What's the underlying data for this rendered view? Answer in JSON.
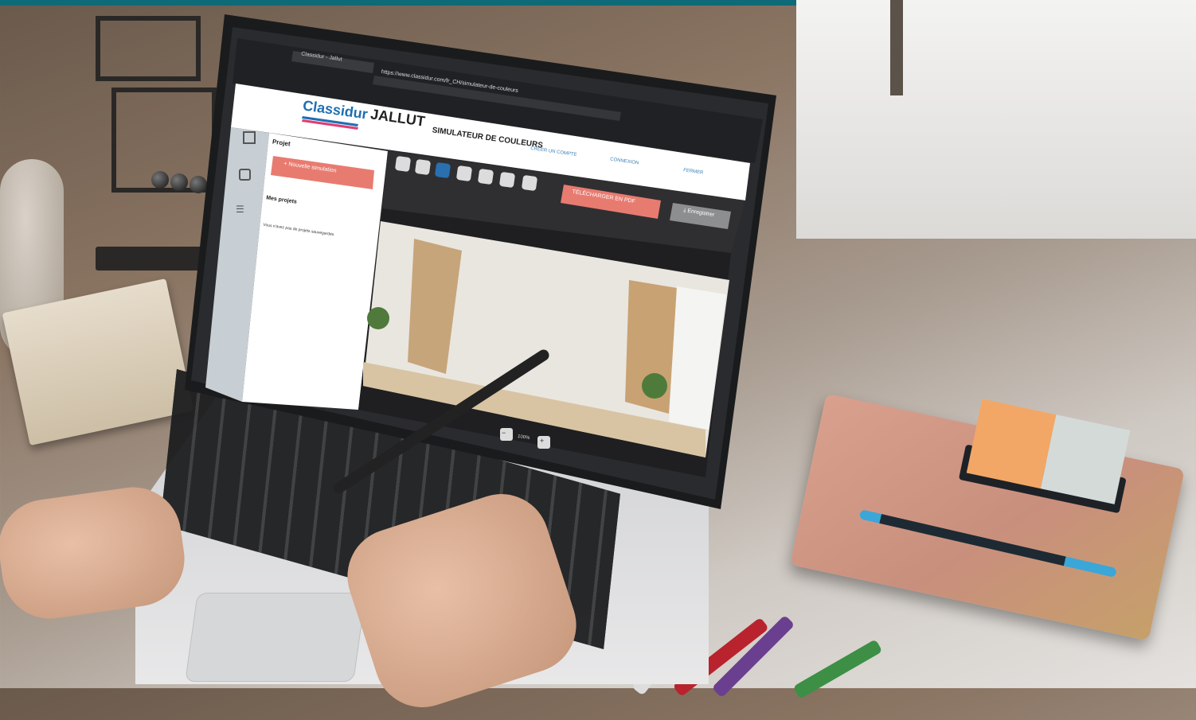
{
  "browser": {
    "tab_title": "Classidur - Jallut",
    "url": "https://www.classidur.com/fr_CH/simulateur-de-couleurs"
  },
  "brand": {
    "logo_1": "Classidur",
    "logo_2": "JALLUT",
    "accent": "#e87b70",
    "teal": "#0f6a78"
  },
  "header": {
    "title": "SIMULATEUR DE COULEURS",
    "create_account": "CRÉER UN COMPTE",
    "login": "CONNEXION",
    "close": "FERMER"
  },
  "sidebar": {
    "section_title": "Projet",
    "new_button": "Nouvelle simulation",
    "projects_title": "Mes projets",
    "empty_text": "Vous n'avez pas de projets sauvegardés"
  },
  "toolbar": {
    "download_pdf": "TÉLÉCHARGER EN PDF",
    "save": "Enregistrer"
  },
  "zoom": {
    "level": "100%"
  },
  "icons": [
    "qr-icon",
    "layers-icon",
    "sliders-icon",
    "undo-icon",
    "redo-icon",
    "wand-icon",
    "brush-icon",
    "eraser-icon",
    "select-icon",
    "fit-icon",
    "zoom-out-icon",
    "zoom-in-icon"
  ]
}
